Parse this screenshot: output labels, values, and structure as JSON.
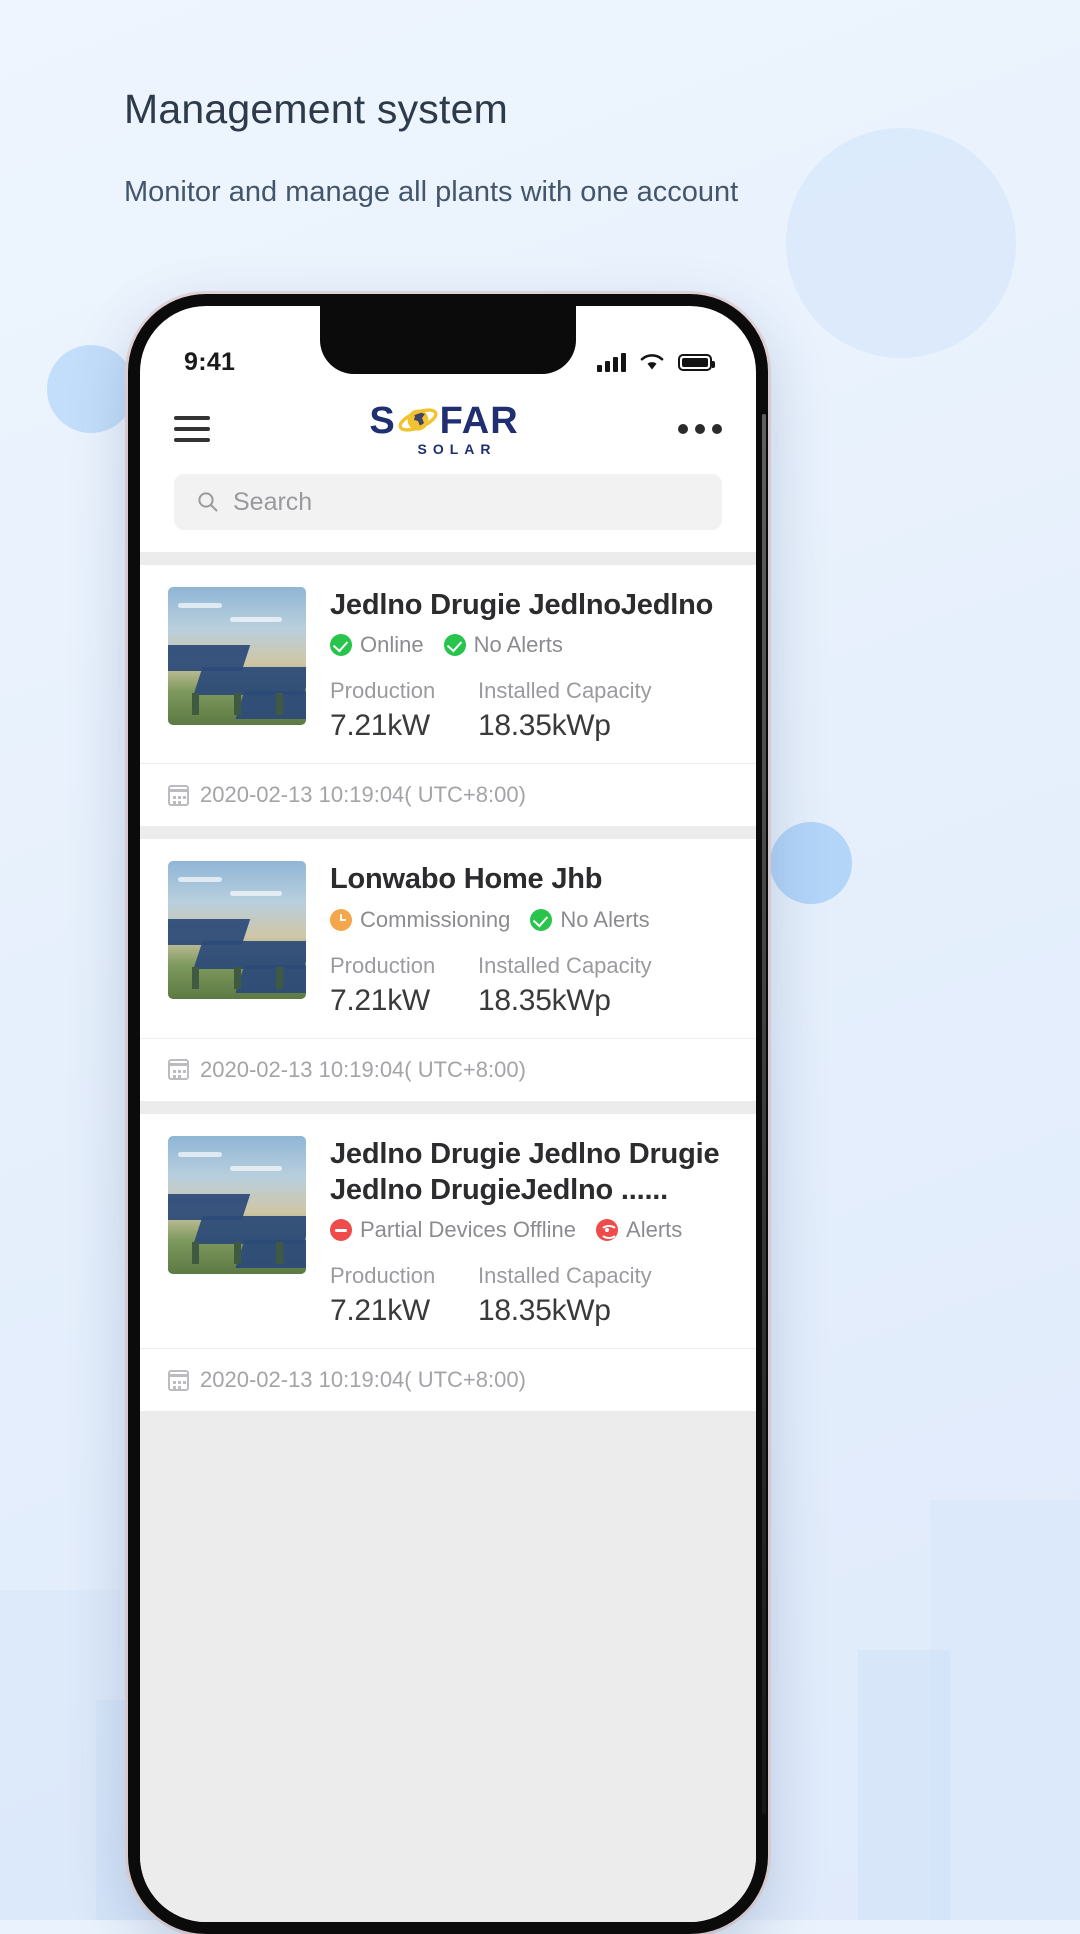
{
  "headline": {
    "title": "Management system",
    "subtitle": "Monitor and manage all plants with one account"
  },
  "status_bar": {
    "time": "9:41",
    "signal_icon": "cellular-signal-icon",
    "wifi_icon": "wifi-icon",
    "battery_icon": "battery-full-icon"
  },
  "nav": {
    "menu_icon": "hamburger-menu-icon",
    "logo_main": "S",
    "logo_main_tail": "FAR",
    "logo_sub": "SOLAR",
    "more_icon": "more-options-icon"
  },
  "search": {
    "placeholder": "Search",
    "icon": "search-icon"
  },
  "colors": {
    "brand_navy": "#1f2f72",
    "brand_gold": "#f2c230",
    "status_online": "#28c44b",
    "status_commissioning": "#f5a64a",
    "status_offline": "#ef4b4b",
    "status_alert": "#ef4b4b"
  },
  "labels": {
    "production": "Production",
    "installed_capacity": "Installed Capacity",
    "calendar_icon": "calendar-icon"
  },
  "plants": [
    {
      "name": "Jedlno Drugie JedlnoJedlno",
      "statuses": [
        {
          "label": "Online",
          "type": "ok",
          "icon": "check-circle-icon"
        },
        {
          "label": "No Alerts",
          "type": "ok",
          "icon": "check-circle-icon"
        }
      ],
      "production": "7.21kW",
      "capacity": "18.35kWp",
      "timestamp": "2020-02-13 10:19:04( UTC+8:00)",
      "thumbnail": "solar-panel-photo"
    },
    {
      "name": "Lonwabo Home Jhb",
      "statuses": [
        {
          "label": "Commissioning",
          "type": "warn",
          "icon": "clock-circle-icon"
        },
        {
          "label": "No Alerts",
          "type": "ok",
          "icon": "check-circle-icon"
        }
      ],
      "production": "7.21kW",
      "capacity": "18.35kWp",
      "timestamp": "2020-02-13 10:19:04( UTC+8:00)",
      "thumbnail": "solar-panel-photo"
    },
    {
      "name": "Jedlno Drugie Jedlno Drugie Jedlno DrugieJedlno ......",
      "statuses": [
        {
          "label": "Partial Devices Offline",
          "type": "err",
          "icon": "minus-circle-icon"
        },
        {
          "label": "Alerts",
          "type": "alert",
          "icon": "broadcast-alert-icon"
        }
      ],
      "production": "7.21kW",
      "capacity": "18.35kWp",
      "timestamp": "2020-02-13 10:19:04( UTC+8:00)",
      "thumbnail": "solar-panel-photo"
    }
  ]
}
